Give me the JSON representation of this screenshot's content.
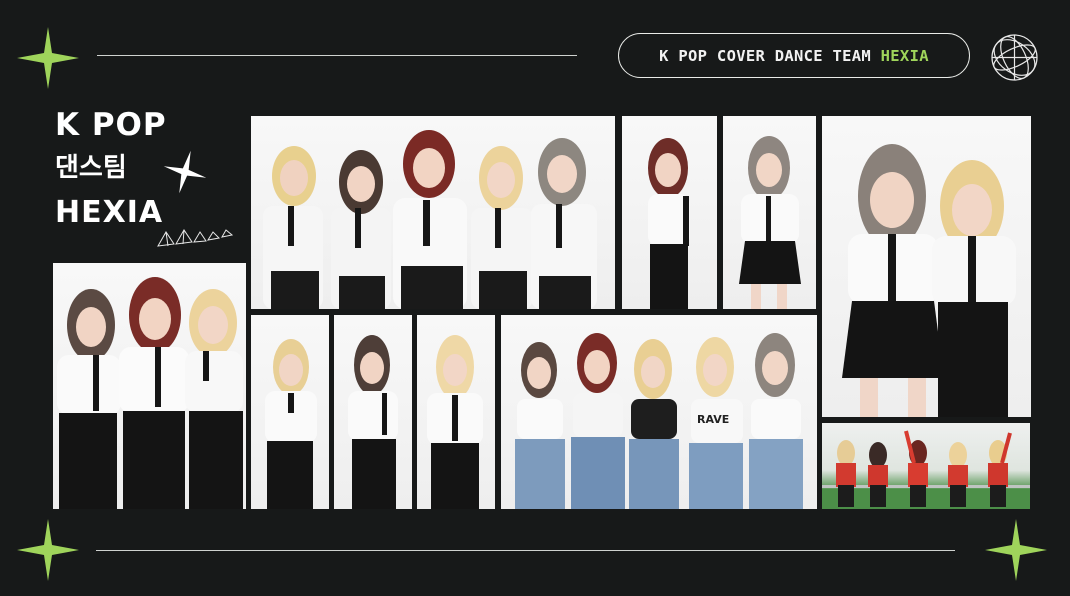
{
  "header": {
    "team_label_prefix": "K POP COVER DANCE TEAM ",
    "team_label_accent": "HEXIA"
  },
  "title": {
    "line1": "K POP",
    "line2": "댄스팀",
    "line3": "HEXIA"
  },
  "colors": {
    "background": "#171919",
    "accent": "#9fd45b",
    "text": "#ffffff"
  },
  "icons": [
    "sparkle-star-icon",
    "globe-wireframe-icon",
    "gem-doodle-icon"
  ]
}
